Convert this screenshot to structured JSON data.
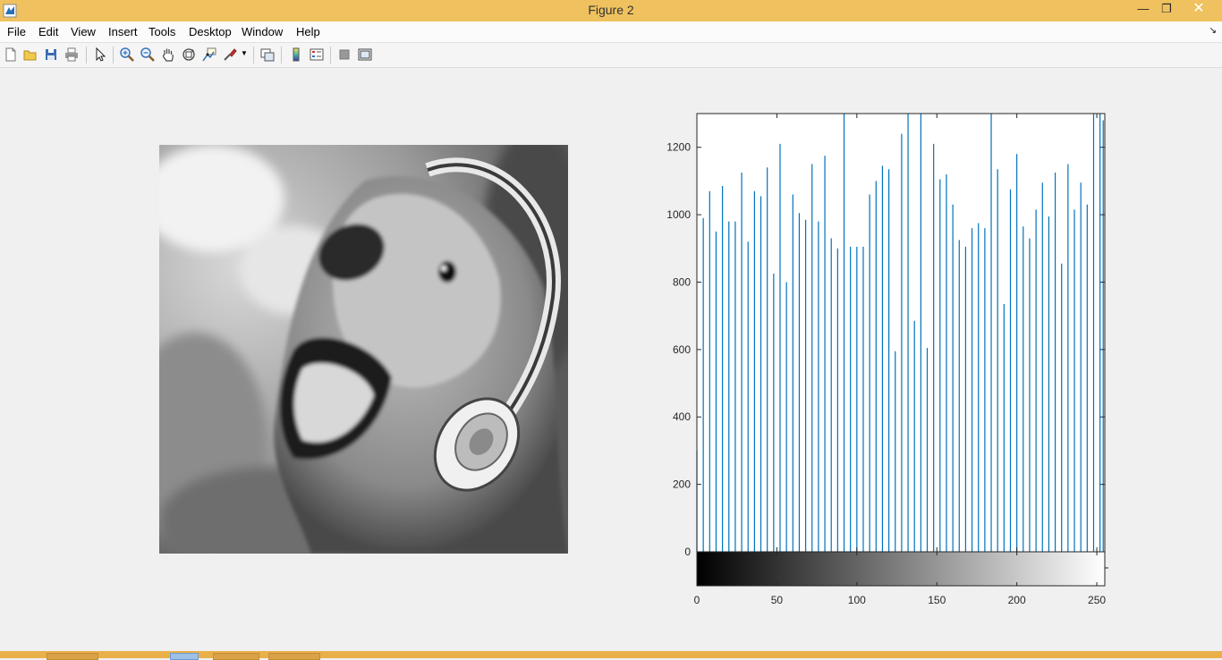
{
  "window": {
    "title": "Figure 2"
  },
  "menu": [
    "File",
    "Edit",
    "View",
    "Insert",
    "Tools",
    "Desktop",
    "Window",
    "Help"
  ],
  "toolbar_icons": [
    "new-figure-icon",
    "open-file-icon",
    "save-icon",
    "print-icon",
    "select-arrow-icon",
    "zoom-in-icon",
    "zoom-out-icon",
    "pan-hand-icon",
    "rotate-3d-icon",
    "data-cursor-icon",
    "brush-icon",
    "link-plot-icon",
    "colorbar-icon",
    "legend-icon",
    "hide-plot-tools-icon",
    "show-plot-tools-icon"
  ],
  "colors": {
    "titlebar": "#efc25f",
    "bar": "#0072bd",
    "axes": "#262626"
  },
  "chart_data": {
    "type": "bar",
    "title": "",
    "xlabel": "",
    "ylabel": "",
    "xlim": [
      0,
      255
    ],
    "ylim": [
      0,
      1300
    ],
    "yticks": [
      0,
      200,
      400,
      600,
      800,
      1000,
      1200
    ],
    "xticks": [
      0,
      50,
      100,
      150,
      200,
      250
    ],
    "colorbar": "grayscale 0-255",
    "x": [
      0,
      4,
      8,
      12,
      16,
      20,
      24,
      28,
      32,
      36,
      40,
      44,
      48,
      52,
      56,
      60,
      64,
      68,
      72,
      76,
      80,
      84,
      88,
      92,
      96,
      100,
      104,
      108,
      112,
      116,
      120,
      124,
      128,
      132,
      136,
      140,
      144,
      148,
      152,
      156,
      160,
      164,
      168,
      172,
      176,
      180,
      184,
      188,
      192,
      196,
      200,
      204,
      208,
      212,
      216,
      220,
      224,
      228,
      232,
      236,
      240,
      244,
      248,
      252,
      254
    ],
    "values": [
      300,
      990,
      1070,
      950,
      1085,
      980,
      980,
      1125,
      920,
      1070,
      1055,
      1140,
      825,
      1210,
      800,
      1060,
      1005,
      985,
      1150,
      980,
      1175,
      930,
      900,
      1300,
      905,
      905,
      905,
      1060,
      1100,
      1145,
      1135,
      595,
      1240,
      1300,
      685,
      1300,
      605,
      1210,
      1105,
      1120,
      1030,
      925,
      905,
      960,
      975,
      960,
      1300,
      1135,
      735,
      1075,
      1180,
      965,
      930,
      1015,
      1095,
      995,
      1125,
      855,
      1150,
      1015,
      1095,
      1030,
      1300,
      1300,
      1280
    ]
  }
}
